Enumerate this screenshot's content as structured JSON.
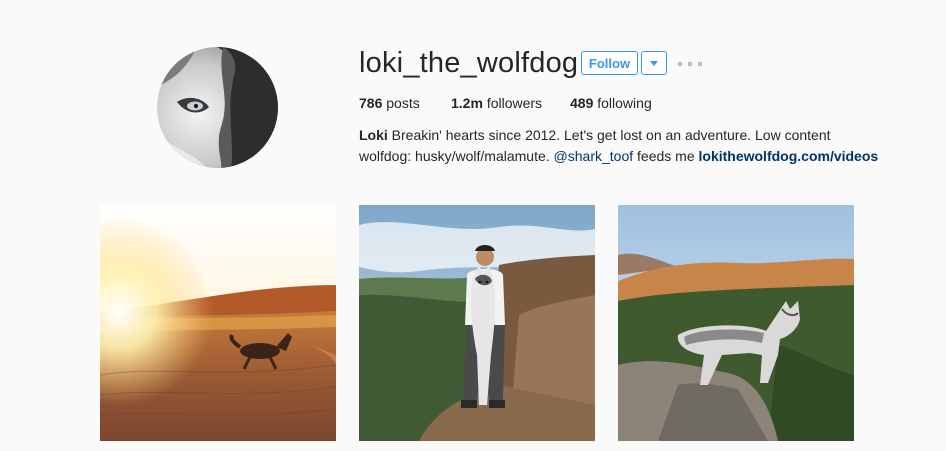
{
  "profile": {
    "username": "loki_the_wolfdog",
    "follow_label": "Follow",
    "stats": {
      "posts_count": "786",
      "posts_label": "posts",
      "followers_count": "1.2m",
      "followers_label": "followers",
      "following_count": "489",
      "following_label": "following"
    },
    "bio": {
      "name": "Loki",
      "line1": " Breakin' hearts since 2012. Let's get lost on an adventure. Low content",
      "line2_prefix": "wolfdog: husky/wolf/malamute. ",
      "mention": "@shark_toof",
      "line2_middle": " feeds me ",
      "link": "lokithewolfdog.com/videos"
    }
  },
  "colors": {
    "accent": "#3897f0",
    "link": "#003569",
    "background": "#fafafa"
  },
  "icons": {
    "dropdown": "chevron-down-icon",
    "more": "more-options-icon"
  },
  "posts": [
    {
      "subject": "husky running on desert dunes at sunset"
    },
    {
      "subject": "man holding wolfdog on mountain summit"
    },
    {
      "subject": "wolfdog standing on rocky ridge"
    }
  ]
}
